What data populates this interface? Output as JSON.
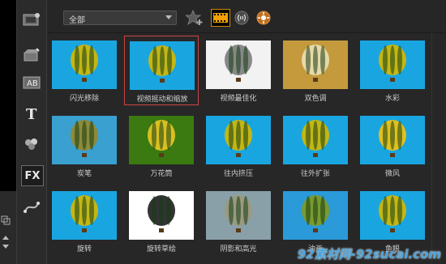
{
  "filter": {
    "selected": "全部"
  },
  "effects": [
    {
      "label": "闪光移除",
      "bg": "#19a6e0",
      "balloon": "#c3b616"
    },
    {
      "label": "视频摇动和缩放",
      "bg": "#19a6e0",
      "balloon": "#c3b616"
    },
    {
      "label": "视频最佳化",
      "bg": "#f2f2f2",
      "balloon": "#888888"
    },
    {
      "label": "双色调",
      "bg": "#c49a3c",
      "balloon": "#e8d8a8"
    },
    {
      "label": "水彩",
      "bg": "#19a6e0",
      "balloon": "#c3b616"
    },
    {
      "label": "炭笔",
      "bg": "#3aa0d0",
      "balloon": "#8d8a3a"
    },
    {
      "label": "万花筒",
      "bg": "#3a7a10",
      "balloon": "#d8c020"
    },
    {
      "label": "往内挤压",
      "bg": "#19a6e0",
      "balloon": "#c3b616"
    },
    {
      "label": "往外扩张",
      "bg": "#19a6e0",
      "balloon": "#c3b616"
    },
    {
      "label": "微风",
      "bg": "#19a6e0",
      "balloon": "#e0c020"
    },
    {
      "label": "旋转",
      "bg": "#19a6e0",
      "balloon": "#c3b616"
    },
    {
      "label": "旋转草绘",
      "bg": "#ffffff",
      "balloon": "#333333"
    },
    {
      "label": "阴影和高光",
      "bg": "#8aa0a8",
      "balloon": "#9a9a80"
    },
    {
      "label": "油画",
      "bg": "#2a9ad8",
      "balloon": "#7a9a30"
    },
    {
      "label": "鱼眼",
      "bg": "#19a6e0",
      "balloon": "#c3b616"
    }
  ],
  "watermark": "92素材网-92sucai.com"
}
